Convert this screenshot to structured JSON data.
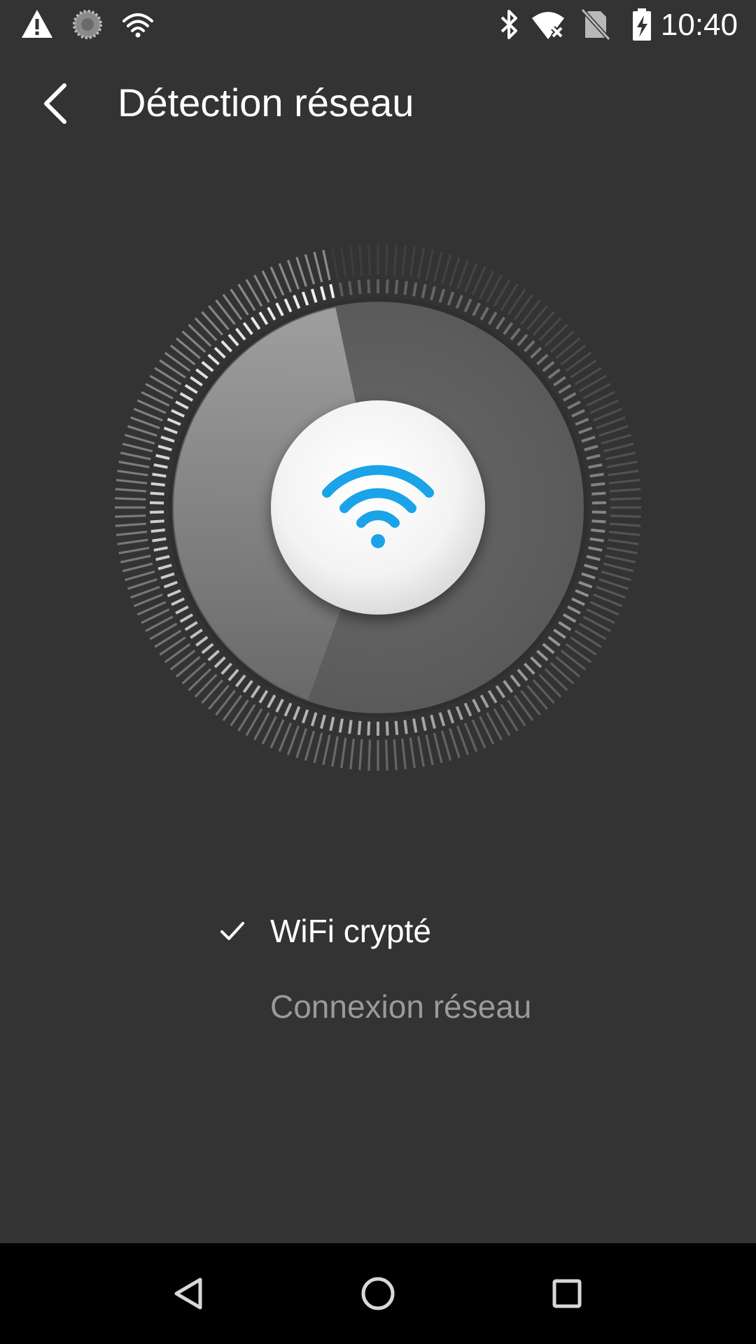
{
  "status_bar": {
    "time": "10:40",
    "left_icons": [
      "warning-icon",
      "loading-icon",
      "wifi-icon"
    ],
    "right_icons": [
      "bluetooth-icon",
      "wifi-no-internet-icon",
      "no-sim-icon",
      "battery-charging-icon"
    ]
  },
  "toolbar": {
    "title": "Détection réseau",
    "back_icon": "back-arrow-icon"
  },
  "scanner": {
    "center_icon": "wifi-icon",
    "accent_color": "#1aa3e8"
  },
  "checklist": {
    "items": [
      {
        "label": "WiFi crypté",
        "status": "done",
        "icon": "check-icon"
      },
      {
        "label": "Connexion réseau",
        "status": "pending"
      }
    ]
  },
  "nav_bar": {
    "buttons": [
      "back-triangle-icon",
      "home-circle-icon",
      "recents-square-icon"
    ]
  },
  "colors": {
    "background": "#333333",
    "nav_background": "#000000",
    "text_primary": "#ffffff",
    "text_secondary": "#9a9a9a"
  }
}
